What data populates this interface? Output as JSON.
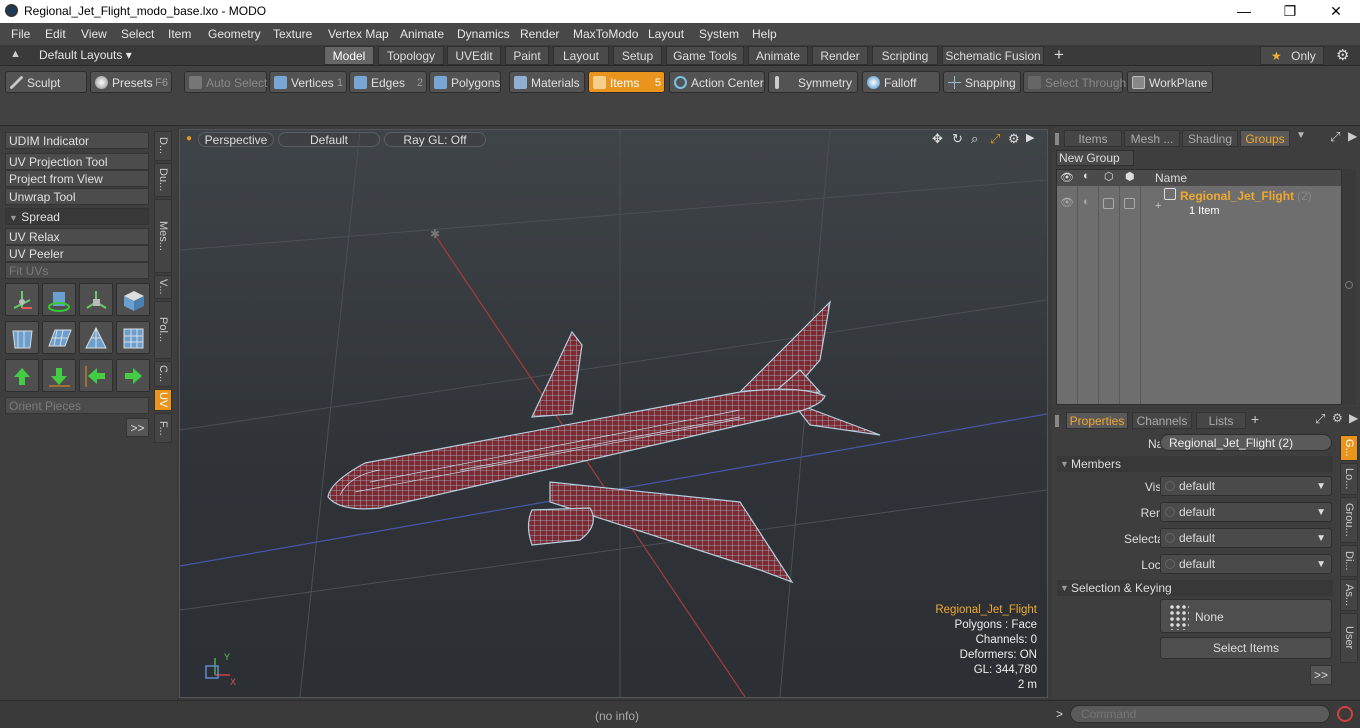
{
  "window": {
    "title": "Regional_Jet_Flight_modo_base.lxo - MODO",
    "minimize": "—",
    "maximize": "❐",
    "close": "✕"
  },
  "menu": [
    "File",
    "Edit",
    "View",
    "Select",
    "Item",
    "Geometry",
    "Texture",
    "Vertex Map",
    "Animate",
    "Dynamics",
    "Render",
    "MaxToModo",
    "Layout",
    "System",
    "Help"
  ],
  "layouts": {
    "dropdown": "Default Layouts ▾",
    "tabs": [
      "Model",
      "Topology",
      "UVEdit",
      "Paint",
      "Layout",
      "Setup",
      "Game Tools",
      "Animate",
      "Render",
      "Scripting",
      "Schematic Fusion"
    ],
    "active": "Model",
    "add": "+",
    "only": "Only"
  },
  "toolbar": {
    "sculpt": "Sculpt",
    "presets": "Presets",
    "presets_key": "F6",
    "auto_select": "Auto Select",
    "vertices": "Vertices",
    "vertices_num": "1",
    "edges": "Edges",
    "edges_num": "2",
    "polygons": "Polygons",
    "materials": "Materials",
    "items": "Items",
    "items_num": "5",
    "action_center": "Action Center",
    "symmetry": "Symmetry",
    "falloff": "Falloff",
    "snapping": "Snapping",
    "select_through": "Select Through",
    "workplane": "WorkPlane"
  },
  "left": {
    "buttons": [
      "UDIM Indicator",
      "UV Projection Tool",
      "Project from View",
      "Unwrap Tool"
    ],
    "spread": "Spread",
    "buttons2": [
      "UV Relax",
      "UV Peeler"
    ],
    "fit_uvs": "Fit UVs",
    "orient": "Orient Pieces",
    "more": ">>",
    "vtabs": [
      "D...",
      "Du...",
      "Mes...",
      "V...",
      "Pol...",
      "C...",
      "UV",
      "F..."
    ]
  },
  "viewport": {
    "perspective": "Perspective",
    "shading": "Default",
    "raygl": "Ray GL: Off",
    "hud": {
      "name": "Regional_Jet_Flight",
      "polygons": "Polygons : Face",
      "channels": "Channels: 0",
      "deformers": "Deformers: ON",
      "gl": "GL: 344,780",
      "scale": "2 m"
    }
  },
  "groups": {
    "tabs": [
      "Items",
      "Mesh ...",
      "Shading",
      "Groups"
    ],
    "active": "Groups",
    "new_group": "New Group",
    "col_name": "Name",
    "item_name": "Regional_Jet_Flight",
    "item_count": "(2)",
    "item_sub": "1 Item"
  },
  "properties": {
    "tabs": [
      "Properties",
      "Channels",
      "Lists"
    ],
    "add": "+",
    "name_label": "Name",
    "name_value": "Regional_Jet_Flight (2)",
    "members": "Members",
    "rows": [
      {
        "label": "Visible",
        "value": "default"
      },
      {
        "label": "Render",
        "value": "default"
      },
      {
        "label": "Selectable",
        "value": "default"
      },
      {
        "label": "Locked",
        "value": "default"
      }
    ],
    "sel_keying": "Selection & Keying",
    "none": "None",
    "select_items": "Select Items",
    "more": ">>",
    "vtabs": [
      "G...",
      "Lo...",
      "Grou...",
      "Di...",
      "As...",
      "User"
    ]
  },
  "status": {
    "info": "(no info)",
    "command_placeholder": "Command",
    "prompt": ">"
  },
  "colors": {
    "accent": "#e8941d",
    "mesh_fill": "#7a2a30",
    "mesh_wire": "#a9c4d8"
  }
}
